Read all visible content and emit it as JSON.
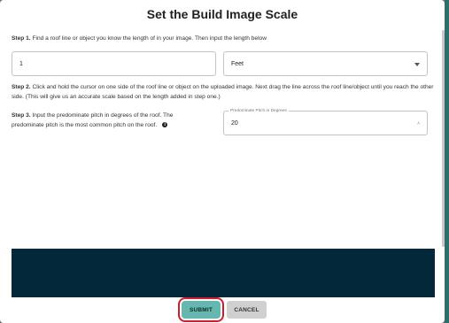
{
  "dialog": {
    "title": "Set the Build Image Scale"
  },
  "step1": {
    "label": "Step 1.",
    "text": " Find a roof line or object you know the length of in your image. Then input the length below",
    "length_value": "1",
    "unit_selected": "Feet"
  },
  "step2": {
    "label": "Step 2.",
    "text": " Click and hold the cursor on one side of the roof line or object on the uploaded image. Next drag the line across the roof line/object until you reach the other side. (This will give us an accurate scale based on the length added in step one.)"
  },
  "step3": {
    "label": "Step 3.",
    "text": " Input the predominate pitch in degrees of the roof. The predominate pitch is the most common pitch on the roof.",
    "info_icon_glyph": "i",
    "pitch_field_label": "Predominate Pitch in Degrees",
    "pitch_value": "20",
    "spin_glyph": "˄"
  },
  "buttons": {
    "submit_label": "SUBMIT",
    "cancel_label": "CANCEL"
  },
  "colors": {
    "image_area": "#03283a",
    "submit_bg": "#67b7b1",
    "highlight_ring": "#cf1d2d",
    "cancel_bg": "#d0d0d0"
  }
}
